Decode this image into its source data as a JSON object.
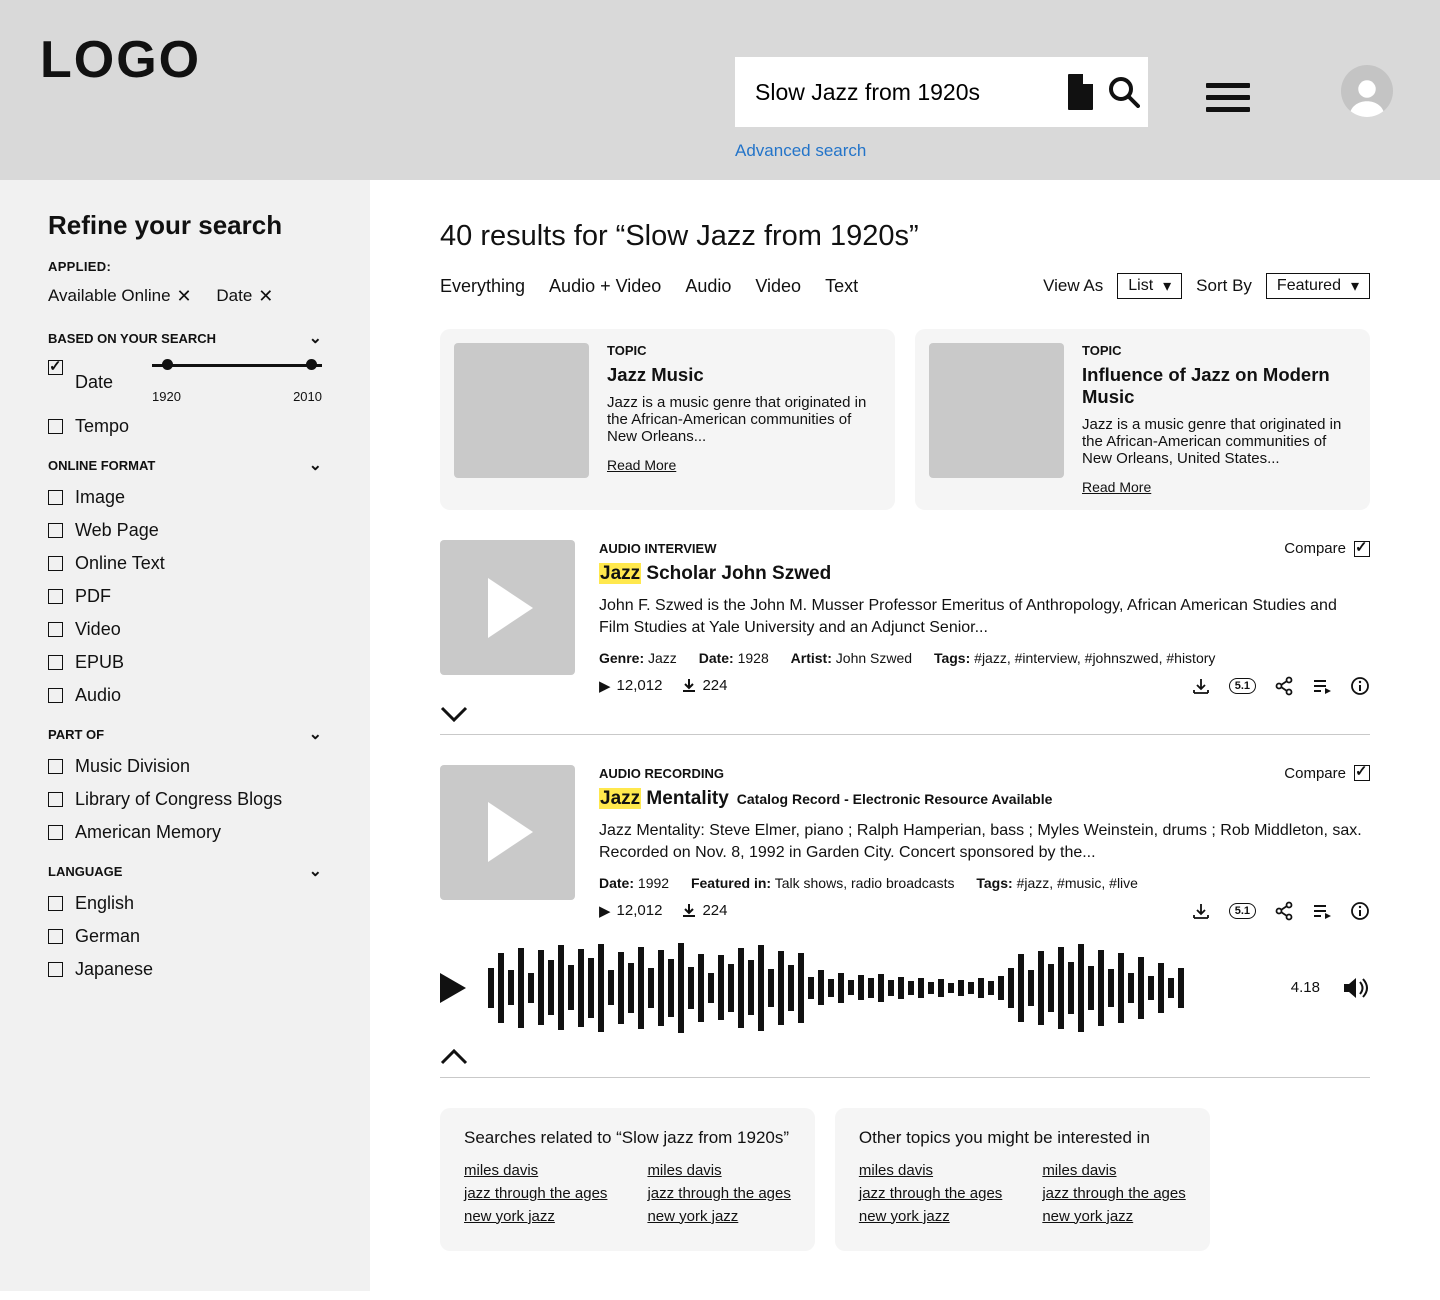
{
  "header": {
    "logo_text": "LOGO",
    "search_value": "Slow Jazz from 1920s",
    "advanced_link": "Advanced search"
  },
  "sidebar": {
    "title": "Refine your search",
    "applied_label": "APPLIED:",
    "applied": [
      "Available Online",
      "Date"
    ],
    "facets": {
      "based_label": "BASED ON YOUR SEARCH",
      "date_label": "Date",
      "tempo_label": "Tempo",
      "slider_min": "1920",
      "slider_max": "2010",
      "format_label": "ONLINE FORMAT",
      "formats": [
        "Image",
        "Web Page",
        "Online Text",
        "PDF",
        "Video",
        "EPUB",
        "Audio"
      ],
      "partof_label": "PART OF",
      "partof": [
        "Music Division",
        "Library of Congress Blogs",
        "American Memory"
      ],
      "language_label": "LANGUAGE",
      "languages": [
        "English",
        "German",
        "Japanese"
      ]
    }
  },
  "main": {
    "heading": "40 results for “Slow Jazz from 1920s”",
    "tabs": [
      "Everything",
      "Audio + Video",
      "Audio",
      "Video",
      "Text"
    ],
    "view_as_label": "View As",
    "view_as_value": "List",
    "sort_label": "Sort By",
    "sort_value": "Featured"
  },
  "topics": [
    {
      "label": "TOPIC",
      "title": "Jazz Music",
      "desc": "Jazz is a music genre that originated in the African-American communities of New Orleans...",
      "more": "Read More"
    },
    {
      "label": "TOPIC",
      "title": "Influence of Jazz on Modern Music",
      "desc": "Jazz is a music genre that originated in the African-American communities of New Orleans, United States...",
      "more": "Read More"
    }
  ],
  "results": [
    {
      "type": "AUDIO INTERVIEW",
      "compare": "Compare",
      "title_pre": "Jazz",
      "title_post": " Scholar John Szwed",
      "catalog": "",
      "desc": "John F. Szwed is the John M. Musser Professor Emeritus of Anthropology, African American Studies and Film Studies at Yale University and an Adjunct Senior...",
      "meta": [
        {
          "k": "Genre:",
          "v": "Jazz"
        },
        {
          "k": "Date:",
          "v": "1928"
        },
        {
          "k": "Artist:",
          "v": "John Szwed"
        },
        {
          "k": "Tags:",
          "v": "#jazz, #interview, #johnszwed, #history"
        }
      ],
      "plays": "12,012",
      "downloads": "224"
    },
    {
      "type": "AUDIO RECORDING",
      "compare": "Compare",
      "title_pre": "Jazz",
      "title_post": " Mentality",
      "catalog": "Catalog Record - Electronic Resource Available",
      "desc": "Jazz Mentality: Steve Elmer, piano ; Ralph Hamperian, bass ; Myles Weinstein, drums ; Rob Middleton, sax. Recorded on Nov. 8, 1992 in Garden City. Concert sponsored by the...",
      "meta": [
        {
          "k": "Date:",
          "v": "1992"
        },
        {
          "k": "Featured in:",
          "v": "Talk shows, radio broadcasts"
        },
        {
          "k": "Tags:",
          "v": "#jazz, #music, #live"
        }
      ],
      "plays": "12,012",
      "downloads": "224"
    }
  ],
  "player": {
    "time": "4.18"
  },
  "footer": {
    "related_title": "Searches related to “Slow jazz from 1920s”",
    "topics_title": "Other topics you might be interested in",
    "links": [
      "miles davis",
      "jazz through the ages",
      "new york jazz"
    ]
  },
  "icons": {
    "surround": "5.1"
  }
}
